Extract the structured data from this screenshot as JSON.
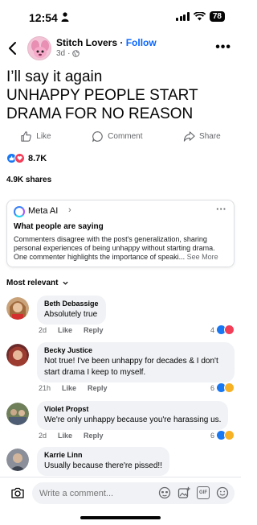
{
  "status": {
    "time": "12:54",
    "battery": "78"
  },
  "post": {
    "page_name": "Stitch Lovers",
    "follow_separator": " · ",
    "follow_label": "Follow",
    "age": "3d",
    "text_line1": "I’ll say it again",
    "text_line2": "UNHAPPY PEOPLE START DRAMA FOR NO REASON"
  },
  "actions": {
    "like": "Like",
    "comment": "Comment",
    "share": "Share"
  },
  "reactions": {
    "count": "8.7K"
  },
  "shares": "4.9K shares",
  "meta_ai": {
    "label": "Meta AI",
    "heading": "What people are saying",
    "summary": "Commenters disagree with the post's generalization, sharing personal experiences of being unhappy without starting drama. One commenter highlights the importance of speaki...",
    "see_more": "See More"
  },
  "sort_label": "Most relevant",
  "comment_actions": {
    "like": "Like",
    "reply": "Reply"
  },
  "comments": [
    {
      "name": "Beth Debassige",
      "text": "Absolutely true",
      "age": "2d",
      "reactions": "4"
    },
    {
      "name": "Becky Justice",
      "text": "Not true! I've been unhappy for decades & I don't start drama I keep to myself.",
      "age": "21h",
      "reactions": "6"
    },
    {
      "name": "Violet Propst",
      "text": "We're only unhappy because you're harassing us.",
      "age": "2d",
      "reactions": "6"
    },
    {
      "name": "Karrie Linn",
      "text": "Usually because there're pissed!!",
      "age": "",
      "reactions": ""
    }
  ],
  "composer": {
    "placeholder": "Write a comment..."
  },
  "colors": {
    "accent": "#0866ff",
    "like": "#1877f2",
    "love": "#f33e58",
    "haha": "#f7b125"
  }
}
